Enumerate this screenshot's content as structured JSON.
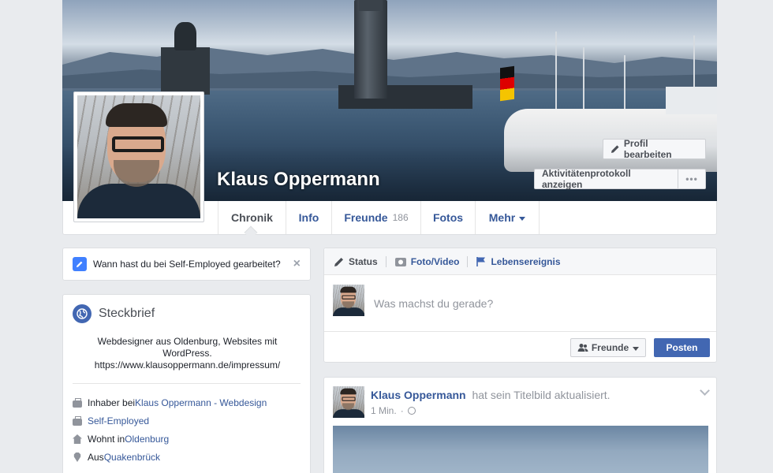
{
  "profile": {
    "name": "Klaus Oppermann",
    "edit_button": "Profil bearbeiten",
    "activity_button": "Aktivitätenprotokoll anzeigen",
    "more_button": "•••"
  },
  "nav": {
    "tabs": [
      {
        "label": "Chronik",
        "active": true
      },
      {
        "label": "Info"
      },
      {
        "label": "Freunde",
        "count": "186"
      },
      {
        "label": "Fotos"
      },
      {
        "label": "Mehr"
      }
    ]
  },
  "prompt": {
    "text": "Wann hast du bei Self-Employed gearbeitet?",
    "close": "×"
  },
  "intro": {
    "title": "Steckbrief",
    "bio_line1": "Webdesigner aus Oldenburg, Websites mit WordPress.",
    "bio_line2": "https://www.klausoppermann.de/impressum/",
    "facts": [
      {
        "icon": "briefcase-icon",
        "prefix": "Inhaber bei ",
        "link": "Klaus Oppermann - Webdesign"
      },
      {
        "icon": "briefcase-icon",
        "prefix": "",
        "link": "Self-Employed"
      },
      {
        "icon": "home-icon",
        "prefix": "Wohnt in ",
        "link": "Oldenburg"
      },
      {
        "icon": "location-pin-icon",
        "prefix": "Aus ",
        "link": "Quakenbrück"
      }
    ]
  },
  "composer": {
    "tabs": [
      {
        "label": "Status",
        "icon": "pencil-icon"
      },
      {
        "label": "Foto/Video",
        "icon": "camera-icon"
      },
      {
        "label": "Lebensereignis",
        "icon": "flag-icon"
      }
    ],
    "placeholder": "Was machst du gerade?",
    "audience": "Freunde",
    "post": "Posten"
  },
  "post": {
    "author": "Klaus Oppermann",
    "action": "hat sein Titelbild aktualisiert.",
    "time": "1 Min.",
    "time_sep": "·"
  },
  "colors": {
    "accent": "#4267b2",
    "link": "#365899",
    "background": "#e9ebee"
  }
}
